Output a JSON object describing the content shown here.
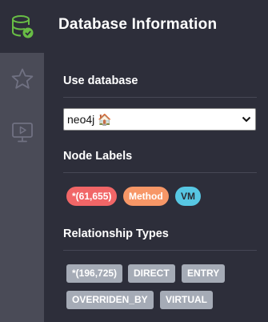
{
  "rail": {
    "items": [
      {
        "icon": "database-check-icon",
        "active": true
      },
      {
        "icon": "star-icon",
        "active": false
      },
      {
        "icon": "video-icon",
        "active": false
      }
    ]
  },
  "panel": {
    "title": "Database Information",
    "use_database": {
      "title": "Use database",
      "selected": "neo4j 🏠"
    },
    "node_labels": {
      "title": "Node Labels",
      "items": [
        {
          "label": "*(61,655)",
          "color": "#f16667",
          "text_color": "#ffffff"
        },
        {
          "label": "Method",
          "color": "#f79767",
          "text_color": "#ffffff"
        },
        {
          "label": "VM",
          "color": "#57c7e3",
          "text_color": "#2a2c34"
        }
      ]
    },
    "relationship_types": {
      "title": "Relationship Types",
      "items": [
        {
          "label": "*(196,725)"
        },
        {
          "label": "DIRECT"
        },
        {
          "label": "ENTRY"
        },
        {
          "label": "OVERRIDEN_BY"
        },
        {
          "label": "VIRTUAL"
        }
      ],
      "tag_color": "#a5abb6"
    }
  },
  "colors": {
    "sidebar": "#4a4b57",
    "panel": "#2d2e3a",
    "accent": "#68bd45"
  }
}
